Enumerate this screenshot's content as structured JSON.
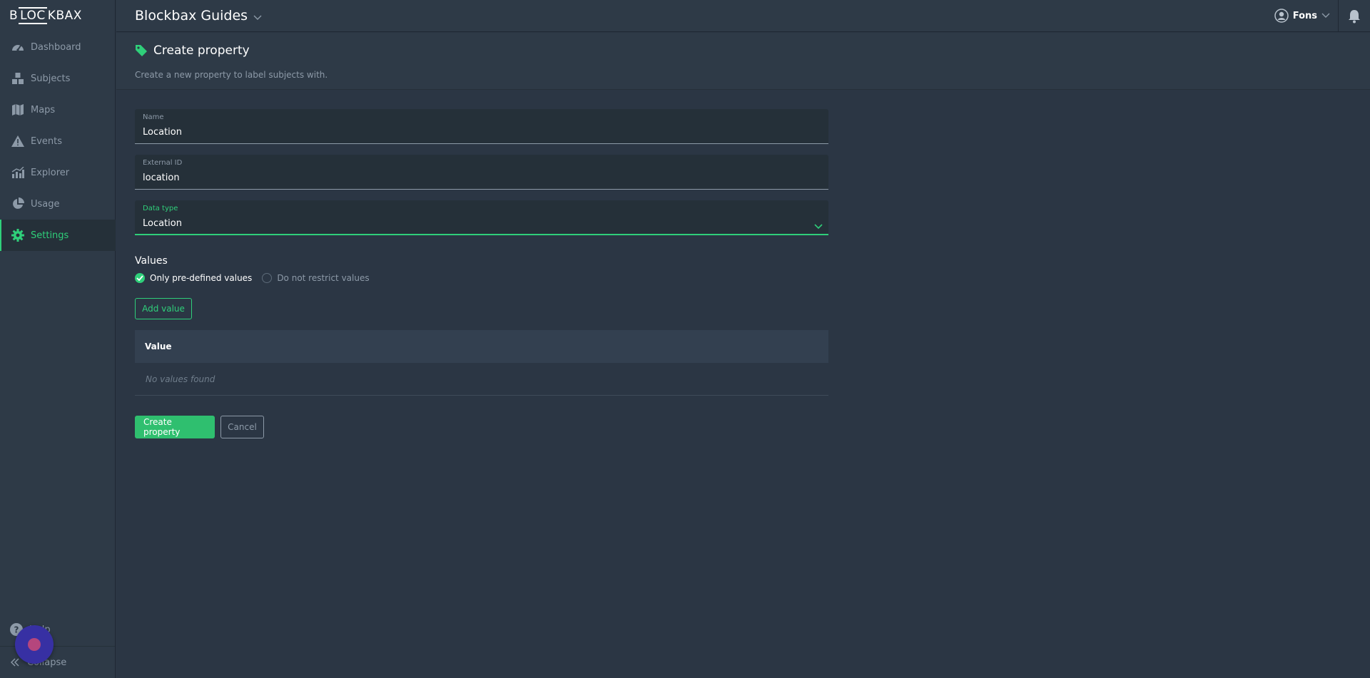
{
  "brand": {
    "logo_text_a": "B",
    "logo_text_b": "LOC",
    "logo_text_c": "KBAX"
  },
  "sidebar": {
    "items": [
      {
        "label": "Dashboard",
        "icon": "dashboard-icon"
      },
      {
        "label": "Subjects",
        "icon": "subjects-icon"
      },
      {
        "label": "Maps",
        "icon": "map-icon"
      },
      {
        "label": "Events",
        "icon": "warning-icon"
      },
      {
        "label": "Explorer",
        "icon": "chart-icon"
      },
      {
        "label": "Usage",
        "icon": "pie-icon"
      },
      {
        "label": "Settings",
        "icon": "gear-icon",
        "active": true
      }
    ],
    "help_label": "Help",
    "collapse_label": "Collapse"
  },
  "topbar": {
    "project_title": "Blockbax Guides",
    "user_name": "Fons"
  },
  "page": {
    "title": "Create property",
    "subtitle": "Create a new property to label subjects with."
  },
  "form": {
    "name": {
      "label": "Name",
      "value": "Location"
    },
    "external_id": {
      "label": "External ID",
      "value": "location"
    },
    "data_type": {
      "label": "Data type",
      "value": "Location"
    }
  },
  "values": {
    "section_title": "Values",
    "option_restricted": "Only pre-defined values",
    "option_unrestricted": "Do not restrict values",
    "add_button": "Add value",
    "table_header": "Value",
    "empty_text": "No values found"
  },
  "actions": {
    "create_label": "Create property",
    "cancel_label": "Cancel"
  },
  "colors": {
    "accent": "#2fcf7a",
    "background": "#2b3644",
    "sidebar": "#2e3a47"
  }
}
